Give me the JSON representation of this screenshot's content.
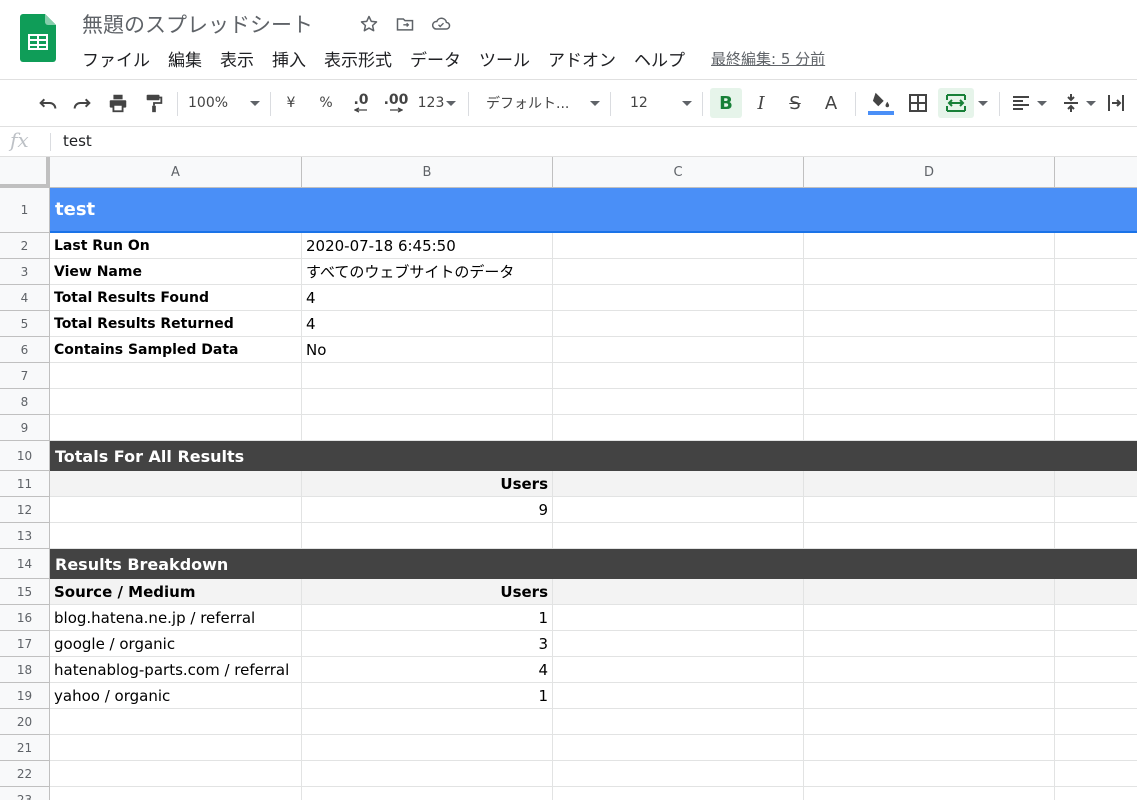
{
  "title": "無題のスプレッドシート",
  "menu": [
    "ファイル",
    "編集",
    "表示",
    "挿入",
    "表示形式",
    "データ",
    "ツール",
    "アドオン",
    "ヘルプ"
  ],
  "last_edit": "最終編集: 5 分前",
  "toolbar": {
    "zoom": "100%",
    "currency": "¥",
    "percent": "%",
    "decimal_decrease": ".0",
    "decimal_increase": ".00",
    "format_more": "123",
    "font": "デフォルト...",
    "font_size": "12",
    "bold": "B",
    "italic": "I",
    "strike": "S",
    "text_color": "A"
  },
  "formula_bar": {
    "fx": "fx",
    "value": "test"
  },
  "columns": [
    "A",
    "B",
    "C",
    "D"
  ],
  "rows": [
    {
      "n": "1",
      "a": "test",
      "b": ""
    },
    {
      "n": "2",
      "a": "Last Run On",
      "b": "2020-07-18 6:45:50"
    },
    {
      "n": "3",
      "a": "View Name",
      "b": "すべてのウェブサイトのデータ"
    },
    {
      "n": "4",
      "a": "Total Results Found",
      "b": "4"
    },
    {
      "n": "5",
      "a": "Total Results Returned",
      "b": "4"
    },
    {
      "n": "6",
      "a": "Contains Sampled Data",
      "b": "No"
    },
    {
      "n": "7",
      "a": "",
      "b": ""
    },
    {
      "n": "8",
      "a": "",
      "b": ""
    },
    {
      "n": "9",
      "a": "",
      "b": ""
    },
    {
      "n": "10",
      "a": "Totals For All Results",
      "b": ""
    },
    {
      "n": "11",
      "a": "",
      "b": "Users"
    },
    {
      "n": "12",
      "a": "",
      "b": "9"
    },
    {
      "n": "13",
      "a": "",
      "b": ""
    },
    {
      "n": "14",
      "a": "Results Breakdown",
      "b": ""
    },
    {
      "n": "15",
      "a": "Source / Medium",
      "b": "Users"
    },
    {
      "n": "16",
      "a": "blog.hatena.ne.jp / referral",
      "b": "1"
    },
    {
      "n": "17",
      "a": "google / organic",
      "b": "3"
    },
    {
      "n": "18",
      "a": "hatenablog-parts.com / referral",
      "b": "4"
    },
    {
      "n": "19",
      "a": "yahoo / organic",
      "b": "1"
    },
    {
      "n": "20",
      "a": "",
      "b": ""
    },
    {
      "n": "21",
      "a": "",
      "b": ""
    },
    {
      "n": "22",
      "a": "",
      "b": ""
    },
    {
      "n": "23",
      "a": "",
      "b": ""
    }
  ],
  "colors": {
    "header_blue": "#4a8ff7",
    "header_dark": "#434343",
    "sheets_green": "#0f9d58"
  }
}
